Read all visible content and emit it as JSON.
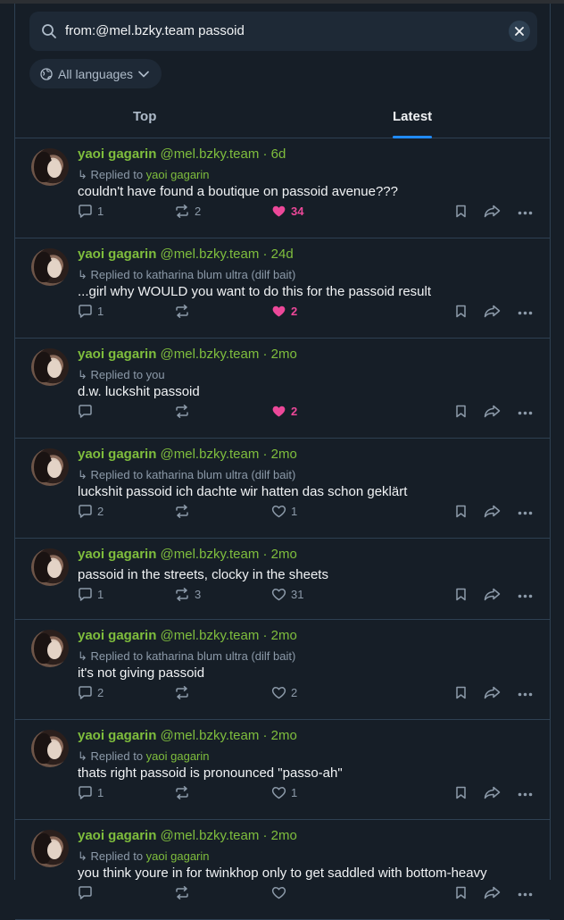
{
  "search": {
    "query": "from:@mel.bzky.team passoid"
  },
  "filter": {
    "language_label": "All languages"
  },
  "tabs": [
    {
      "label": "Top",
      "active": false
    },
    {
      "label": "Latest",
      "active": true
    }
  ],
  "colors": {
    "accent": "#208bfe",
    "name": "#7fbe3d",
    "like": "#ec4899",
    "muted": "#8c9aa9"
  },
  "posts": [
    {
      "name": "yaoi gagarin",
      "handle": "@mel.bzky.team",
      "time": "· 6d",
      "reply_prefix": "↳ Replied to",
      "reply_to": "yaoi gagarin",
      "reply_highlight": true,
      "text": "couldn't have found a boutique on passoid avenue???",
      "replies": "1",
      "reposts": "2",
      "likes": "34",
      "liked": true
    },
    {
      "name": "yaoi gagarin",
      "handle": "@mel.bzky.team",
      "time": "· 24d",
      "reply_prefix": "↳ Replied to",
      "reply_to": "katharina blum ultra (dilf bait)",
      "reply_highlight": false,
      "text": "...girl why WOULD you want to do this for the passoid result",
      "replies": "1",
      "reposts": "",
      "likes": "2",
      "liked": true
    },
    {
      "name": "yaoi gagarin",
      "handle": "@mel.bzky.team",
      "time": "· 2mo",
      "reply_prefix": "↳ Replied to",
      "reply_to": "you",
      "reply_highlight": false,
      "text": "d.w. luckshit passoid",
      "replies": "",
      "reposts": "",
      "likes": "2",
      "liked": true
    },
    {
      "name": "yaoi gagarin",
      "handle": "@mel.bzky.team",
      "time": "· 2mo",
      "reply_prefix": "↳ Replied to",
      "reply_to": "katharina blum ultra (dilf bait)",
      "reply_highlight": false,
      "text": "luckshit passoid ich dachte wir hatten das schon geklärt",
      "replies": "2",
      "reposts": "",
      "likes": "1",
      "liked": false
    },
    {
      "name": "yaoi gagarin",
      "handle": "@mel.bzky.team",
      "time": "· 2mo",
      "reply_prefix": "",
      "reply_to": "",
      "reply_highlight": false,
      "text": "passoid in the streets, clocky in the sheets",
      "replies": "1",
      "reposts": "3",
      "likes": "31",
      "liked": false
    },
    {
      "name": "yaoi gagarin",
      "handle": "@mel.bzky.team",
      "time": "· 2mo",
      "reply_prefix": "↳ Replied to",
      "reply_to": "katharina blum ultra (dilf bait)",
      "reply_highlight": false,
      "text": "it's not giving passoid",
      "replies": "2",
      "reposts": "",
      "likes": "2",
      "liked": false
    },
    {
      "name": "yaoi gagarin",
      "handle": "@mel.bzky.team",
      "time": "· 2mo",
      "reply_prefix": "↳ Replied to",
      "reply_to": "yaoi gagarin",
      "reply_highlight": true,
      "text": "thats right passoid is pronounced \"passo-ah\"",
      "replies": "1",
      "reposts": "",
      "likes": "1",
      "liked": false
    },
    {
      "name": "yaoi gagarin",
      "handle": "@mel.bzky.team",
      "time": "· 2mo",
      "reply_prefix": "↳ Replied to",
      "reply_to": "yaoi gagarin",
      "reply_highlight": true,
      "text": "you think youre in for twinkhop only to get saddled with bottom-heavy",
      "replies": "",
      "reposts": "",
      "likes": "",
      "liked": false
    }
  ]
}
